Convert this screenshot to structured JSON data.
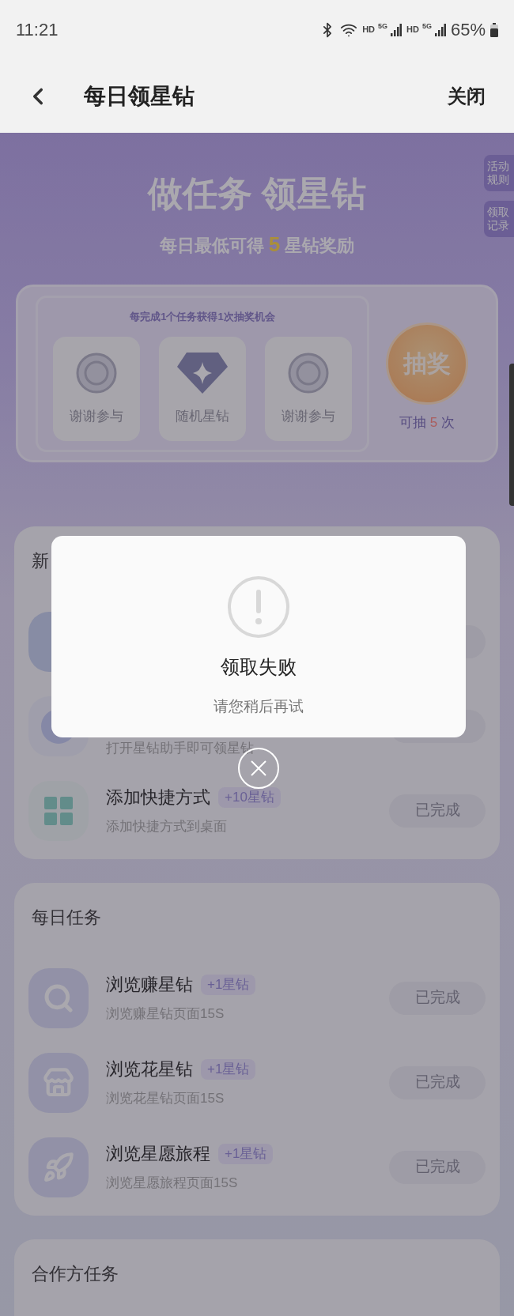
{
  "status_bar": {
    "time": "11:21",
    "sims": [
      {
        "hd": "HD",
        "net": "5G"
      },
      {
        "hd": "HD",
        "net": "5G"
      }
    ],
    "battery": "65%"
  },
  "nav": {
    "title": "每日领星钻",
    "close": "关闭"
  },
  "banner": {
    "title": "做任务 领星钻",
    "subtitle_prefix": "每日最低可得",
    "subtitle_count": "5",
    "subtitle_suffix": "星钻奖励",
    "side_buttons": [
      "活动规则",
      "领取记录"
    ]
  },
  "lottery": {
    "hint": "每完成1个任务获得1次抽奖机会",
    "prizes": [
      {
        "kind": "thanks",
        "label": "谢谢参与"
      },
      {
        "kind": "diamond",
        "label": "随机星钻"
      },
      {
        "kind": "thanks",
        "label": "谢谢参与"
      }
    ],
    "draw_button": "抽奖",
    "remaining_prefix": "可抽",
    "remaining_count": "5",
    "remaining_suffix": "次"
  },
  "sections": [
    {
      "title": "新",
      "tasks": [
        {
          "kind": "app"
        },
        {
          "kind": "circle",
          "subtitle": "打开星钻助手即可领星钻"
        },
        {
          "kind": "grid",
          "title": "添加快捷方式",
          "reward": "+10星钻",
          "subtitle": "添加快捷方式到桌面",
          "status": "已完成"
        }
      ]
    },
    {
      "title": "每日任务",
      "tasks": [
        {
          "kind": "search",
          "title": "浏览赚星钻",
          "reward": "+1星钻",
          "subtitle": "浏览赚星钻页面15S",
          "status": "已完成"
        },
        {
          "kind": "shop",
          "title": "浏览花星钻",
          "reward": "+1星钻",
          "subtitle": "浏览花星钻页面15S",
          "status": "已完成"
        },
        {
          "kind": "rocket",
          "title": "浏览星愿旅程",
          "reward": "+1星钻",
          "subtitle": "浏览星愿旅程页面15S",
          "status": "已完成"
        }
      ]
    },
    {
      "title": "合作方任务"
    }
  ],
  "dialog": {
    "title": "领取失败",
    "message": "请您稍后再试"
  }
}
